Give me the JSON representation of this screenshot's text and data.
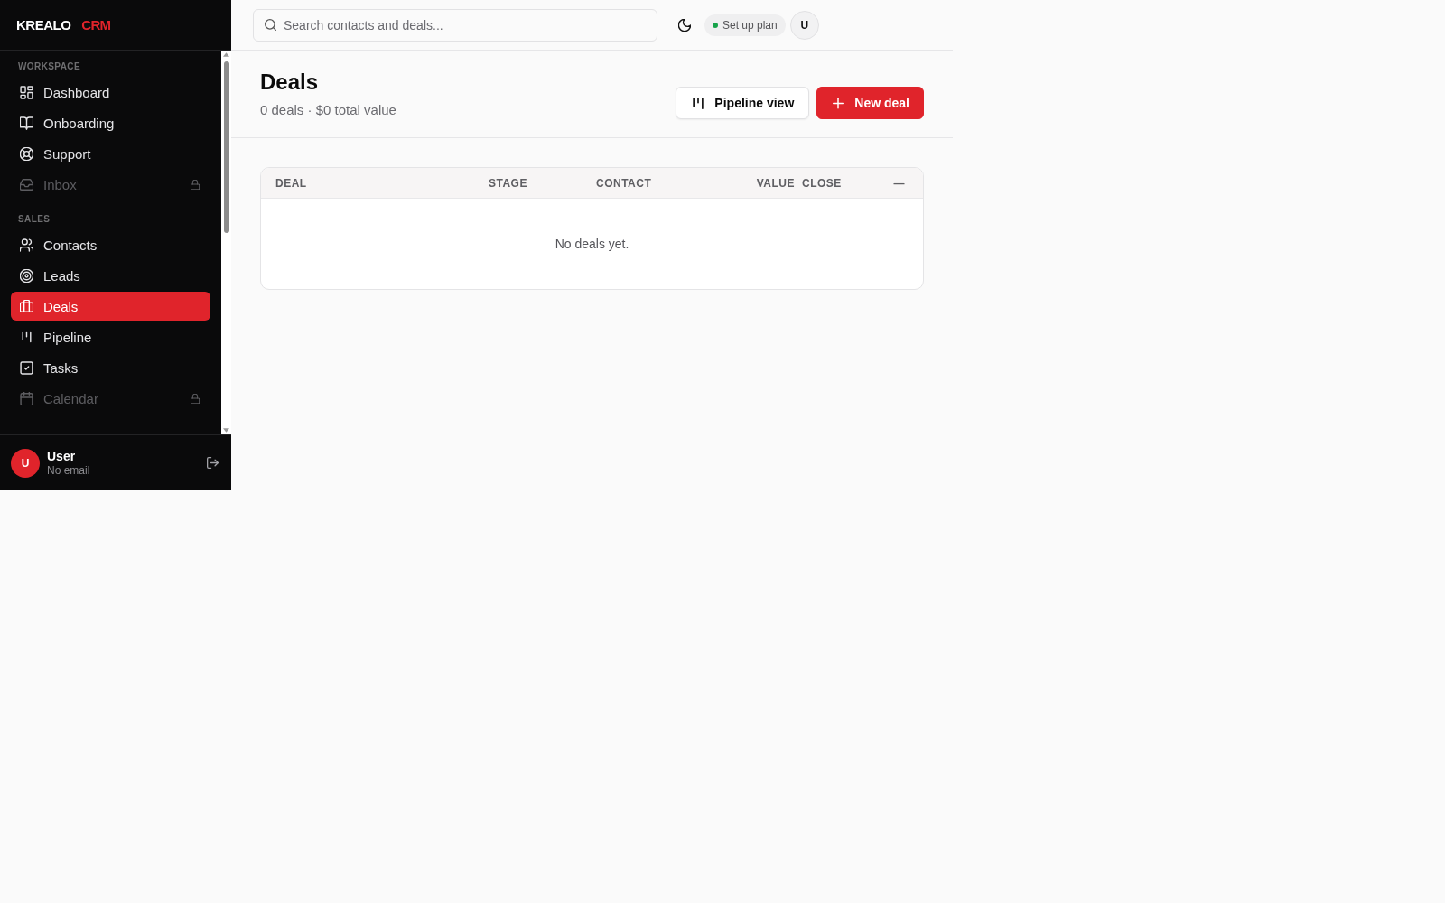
{
  "brand": {
    "name": "KREALO",
    "suffix": "CRM"
  },
  "sidebar": {
    "sections": [
      {
        "label": "WORKSPACE",
        "items": [
          {
            "label": "Dashboard",
            "selected": false,
            "disabled": false
          },
          {
            "label": "Onboarding",
            "selected": false,
            "disabled": false
          },
          {
            "label": "Support",
            "selected": false,
            "disabled": false
          },
          {
            "label": "Inbox",
            "selected": false,
            "disabled": true
          }
        ]
      },
      {
        "label": "SALES",
        "items": [
          {
            "label": "Contacts",
            "selected": false,
            "disabled": false
          },
          {
            "label": "Leads",
            "selected": false,
            "disabled": false
          },
          {
            "label": "Deals",
            "selected": true,
            "disabled": false
          },
          {
            "label": "Pipeline",
            "selected": false,
            "disabled": false
          },
          {
            "label": "Tasks",
            "selected": false,
            "disabled": false
          },
          {
            "label": "Calendar",
            "selected": false,
            "disabled": true
          }
        ]
      }
    ],
    "user": {
      "initial": "U",
      "name": "User",
      "email": "No email"
    }
  },
  "topbar": {
    "search": {
      "placeholder": "Search contacts and deals..."
    },
    "plan_badge": {
      "label": "Set up plan"
    },
    "avatar": {
      "initial": "U"
    }
  },
  "page": {
    "title": "Deals",
    "subtitle": "0 deals · $0 total value",
    "buttons": [
      {
        "label": "Pipeline view",
        "kind": "secondary"
      },
      {
        "label": "New deal",
        "kind": "primary"
      }
    ]
  },
  "table": {
    "columns": [
      "DEAL",
      "STAGE",
      "CONTACT",
      "VALUE",
      "CLOSE",
      "—"
    ],
    "empty_message": "No deals yet."
  }
}
